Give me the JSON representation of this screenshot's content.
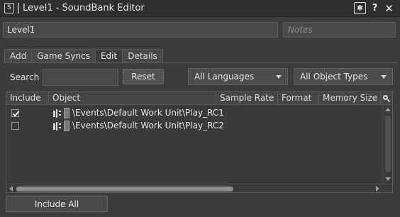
{
  "window": {
    "app_icon_glyph": "S",
    "title": "Level1 - SoundBank Editor",
    "buttons": {
      "pin": "✱",
      "help": "?",
      "close": "✕"
    }
  },
  "soundbank": {
    "name": "Level1",
    "notes_placeholder": "Notes"
  },
  "tabs": [
    {
      "label": "Add",
      "active": false
    },
    {
      "label": "Game Syncs",
      "active": false
    },
    {
      "label": "Edit",
      "active": true
    },
    {
      "label": "Details",
      "active": false
    }
  ],
  "filter": {
    "search_label": "Search",
    "search_value": "",
    "reset_label": "Reset",
    "language_selected": "All Languages",
    "object_type_selected": "All Object Types"
  },
  "table": {
    "columns": [
      "Include",
      "Object",
      "Sample Rate",
      "Format",
      "Memory Size"
    ],
    "rows": [
      {
        "included": true,
        "object": "\\Events\\Default Work Unit\\Play_RC1"
      },
      {
        "included": false,
        "object": "\\Events\\Default Work Unit\\Play_RC2"
      }
    ]
  },
  "footer": {
    "include_all_label": "Include All"
  },
  "icons": {
    "app": "soundbank-app-icon",
    "pin": "asterisk-pin-icon",
    "help": "help-icon",
    "close": "close-icon",
    "column_search": "search-icon",
    "row_type": "event-icon",
    "row_object": "work-unit-icon"
  },
  "colors": {
    "background": "#3c3c3c",
    "titlebar": "#2f2f2f",
    "text": "#dcdcdc",
    "input": "#4a4a4a"
  }
}
